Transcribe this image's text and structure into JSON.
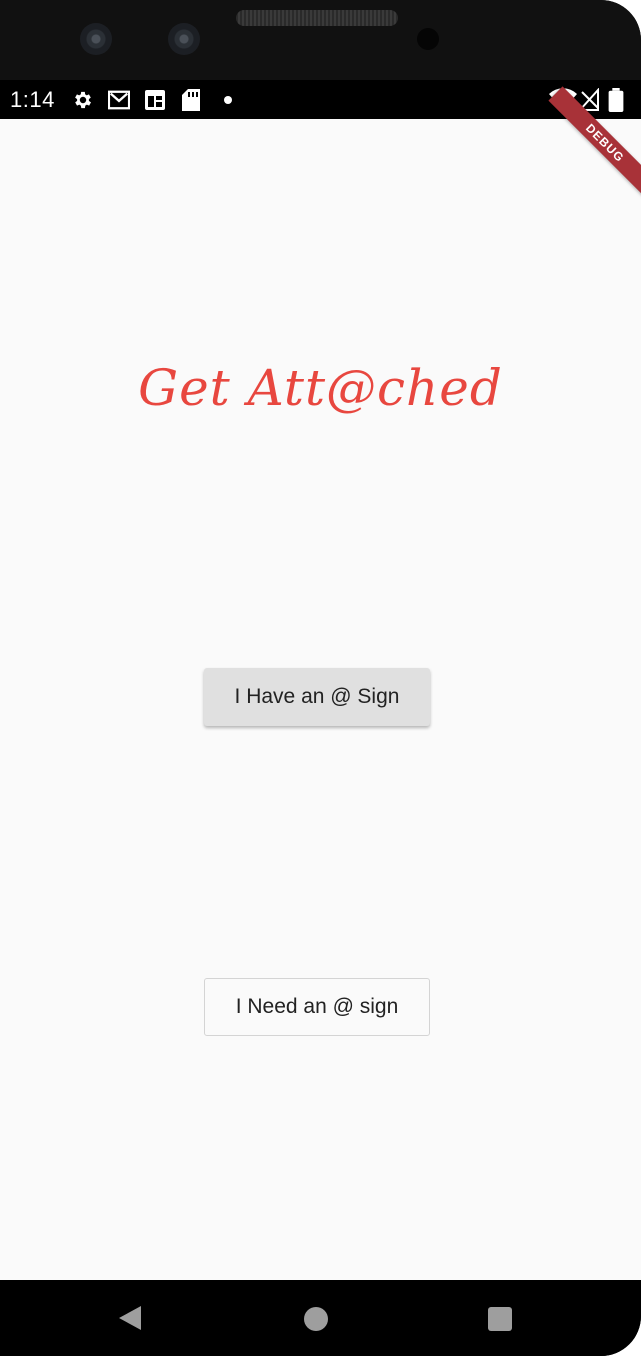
{
  "status_bar": {
    "time": "1:14",
    "icons": [
      "gear-icon",
      "gmail-icon",
      "calendar-icon",
      "sd-card-icon",
      "dot-icon"
    ],
    "right_icons": [
      "wifi-icon",
      "signal-icon",
      "battery-icon"
    ]
  },
  "debug_banner": "DEBUG",
  "app": {
    "title": "Get Att@ched",
    "title_color": "#e8473f",
    "have_button": "I Have an @ Sign",
    "need_button": "I Need an @ sign"
  },
  "nav": {
    "icons": [
      "back-icon",
      "home-icon",
      "recents-icon"
    ]
  }
}
